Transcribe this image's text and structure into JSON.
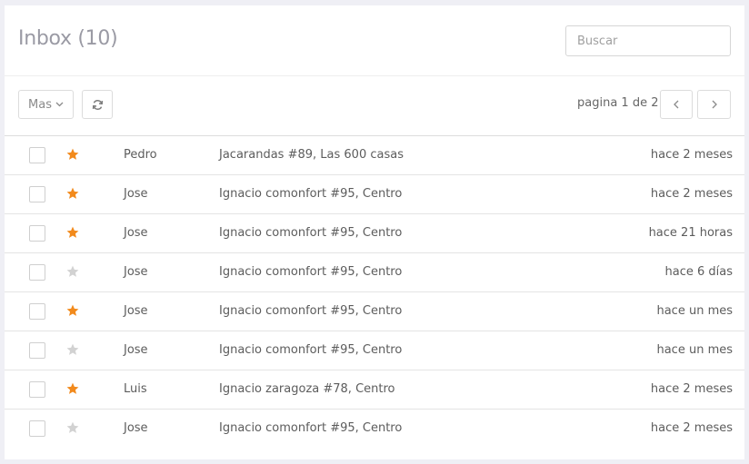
{
  "header": {
    "title": "Inbox (10)",
    "search_placeholder": "Buscar"
  },
  "toolbar": {
    "more_label": "Mas",
    "refresh_icon": "refresh-icon",
    "pagination": "pagina 1 de 2",
    "prev_icon": "chevron-left-icon",
    "next_icon": "chevron-right-icon"
  },
  "colors": {
    "star_active": "#f28a1c",
    "star_inactive": "#d2d2d2"
  },
  "messages": [
    {
      "starred": true,
      "sender": "Pedro",
      "subject": "Jacarandas #89, Las 600 casas",
      "time": "hace 2 meses"
    },
    {
      "starred": true,
      "sender": "Jose",
      "subject": "Ignacio comonfort #95, Centro",
      "time": "hace 2 meses"
    },
    {
      "starred": true,
      "sender": "Jose",
      "subject": "Ignacio comonfort #95, Centro",
      "time": "hace 21 horas"
    },
    {
      "starred": false,
      "sender": "Jose",
      "subject": "Ignacio comonfort #95, Centro",
      "time": "hace 6 días"
    },
    {
      "starred": true,
      "sender": "Jose",
      "subject": "Ignacio comonfort #95, Centro",
      "time": "hace un mes"
    },
    {
      "starred": false,
      "sender": "Jose",
      "subject": "Ignacio comonfort #95, Centro",
      "time": "hace un mes"
    },
    {
      "starred": true,
      "sender": "Luis",
      "subject": "Ignacio zaragoza #78, Centro",
      "time": "hace 2 meses"
    },
    {
      "starred": false,
      "sender": "Jose",
      "subject": "Ignacio comonfort #95, Centro",
      "time": "hace 2 meses"
    }
  ]
}
